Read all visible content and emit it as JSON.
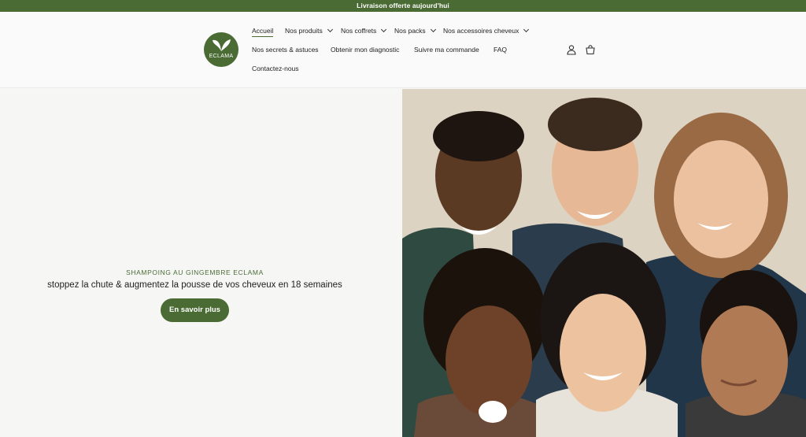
{
  "announcement": "Livraison offerte aujourd'hui",
  "brand": {
    "logo_text": "ECLAMA",
    "accent": "#4a6b34"
  },
  "nav": {
    "row1": [
      {
        "label": "Accueil",
        "active": true,
        "dropdown": false
      },
      {
        "label": "Nos produits",
        "dropdown": true
      },
      {
        "label": "Nos coffrets",
        "dropdown": true
      },
      {
        "label": "Nos packs",
        "dropdown": true
      },
      {
        "label": "Nos accessoires cheveux",
        "dropdown": true
      }
    ],
    "row2": [
      {
        "label": "Nos secrets & astuces"
      },
      {
        "label": "Obtenir mon diagnostic"
      },
      {
        "label": "Suivre ma commande"
      },
      {
        "label": "FAQ"
      }
    ],
    "row3": [
      {
        "label": "Contactez-nous"
      }
    ]
  },
  "header_icons": [
    "account-icon",
    "cart-icon"
  ],
  "hero": {
    "eyebrow": "SHAMPOING AU GINGEMBRE ECLAMA",
    "headline": "stoppez la chute & augmentez la pousse de vos cheveux en 18 semaines",
    "cta_label": "En savoir plus",
    "image": "group-of-smiling-people-photo"
  }
}
